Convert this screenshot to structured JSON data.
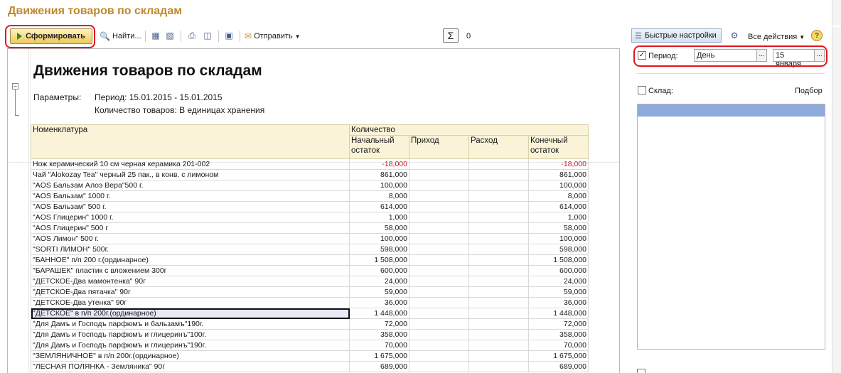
{
  "window": {
    "title": "Движения товаров по складам"
  },
  "toolbar": {
    "generate_label": "Сформировать",
    "find_label": "Найти...",
    "send_label": "Отправить",
    "sum_value": "0"
  },
  "panel_toolbar": {
    "quick_settings_label": "Быстрые настройки",
    "all_actions_label": "Все действия",
    "help_label": "?"
  },
  "settings": {
    "period_label": "Период:",
    "period_checked": true,
    "period_type": "День",
    "period_date": "15 января",
    "warehouse_label": "Склад:",
    "warehouse_checked": false,
    "pick_label": "Подбор"
  },
  "report": {
    "title": "Движения товаров по складам",
    "params_label": "Параметры:",
    "param_period": "Период: 15.01.2015 - 15.01.2015",
    "param_qty": "Количество товаров: В единицах хранения",
    "columns": {
      "name": "Номенклатура",
      "qty_group": "Количество",
      "start": "Начальный остаток",
      "in": "Приход",
      "out": "Расход",
      "end": "Конечный остаток"
    },
    "rows": [
      {
        "name": "Нож керамический 10 см черная керамика 201-002",
        "start": "-18,000",
        "in": "",
        "out": "",
        "end": "-18,000"
      },
      {
        "name": "Чай \"Alokozay Tea\" черный 25 пак., в конв. с лимоном",
        "start": "861,000",
        "in": "",
        "out": "",
        "end": "861,000"
      },
      {
        "name": "\"AOS Бальзам Алоэ Вера\"500 г.",
        "start": "100,000",
        "in": "",
        "out": "",
        "end": "100,000"
      },
      {
        "name": "\"AOS Бальзам\" 1000 г.",
        "start": "8,000",
        "in": "",
        "out": "",
        "end": "8,000"
      },
      {
        "name": "\"AOS Бальзам\" 500 г.",
        "start": "614,000",
        "in": "",
        "out": "",
        "end": "614,000"
      },
      {
        "name": "\"AOS Глицерин\" 1000 г.",
        "start": "1,000",
        "in": "",
        "out": "",
        "end": "1,000"
      },
      {
        "name": "\"AOS Глицерин\" 500 г",
        "start": "58,000",
        "in": "",
        "out": "",
        "end": "58,000"
      },
      {
        "name": "\"AOS Лимон\" 500 г.",
        "start": "100,000",
        "in": "",
        "out": "",
        "end": "100,000"
      },
      {
        "name": "\"SORTI ЛИМОН\" 500г.",
        "start": "598,000",
        "in": "",
        "out": "",
        "end": "598,000"
      },
      {
        "name": "\"БАННОЕ\" п/п 200 г.(ординарное)",
        "start": "1 508,000",
        "in": "",
        "out": "",
        "end": "1 508,000"
      },
      {
        "name": "\"БАРАШЕК\" пластик с вложением 300г",
        "start": "600,000",
        "in": "",
        "out": "",
        "end": "600,000"
      },
      {
        "name": "\"ДЕТСКОЕ-Два мамонтенка\" 90г",
        "start": "24,000",
        "in": "",
        "out": "",
        "end": "24,000"
      },
      {
        "name": "\"ДЕТСКОЕ-Два пятачка\" 90г",
        "start": "59,000",
        "in": "",
        "out": "",
        "end": "59,000"
      },
      {
        "name": "\"ДЕТСКОЕ-Два утенка\" 90г",
        "start": "36,000",
        "in": "",
        "out": "",
        "end": "36,000"
      },
      {
        "name": "\"ДЕТСКОЕ\" в п/п 200г.(ординарное)",
        "start": "1 448,000",
        "in": "",
        "out": "",
        "end": "1 448,000"
      },
      {
        "name": "\"Для Дамъ и Господъ парфюмъ и бальзамъ\"190г.",
        "start": "72,000",
        "in": "",
        "out": "",
        "end": "72,000"
      },
      {
        "name": "\"Для Дамъ и Господъ парфюмъ и глицеринъ\"100г.",
        "start": "358,000",
        "in": "",
        "out": "",
        "end": "358,000"
      },
      {
        "name": "\"Для Дамъ и Господъ парфюмъ и глицеринъ\"190г.",
        "start": "70,000",
        "in": "",
        "out": "",
        "end": "70,000"
      },
      {
        "name": "\"ЗЕМЛЯНИЧНОЕ\" в п/п 200г.(ординарное)",
        "start": "1 675,000",
        "in": "",
        "out": "",
        "end": "1 675,000"
      },
      {
        "name": "\"ЛЕСНАЯ ПОЛЯНКА - Земляника\" 90г",
        "start": "689,000",
        "in": "",
        "out": "",
        "end": "689,000"
      }
    ],
    "selected_row": 14
  },
  "colors": {
    "accent": "#c0882a",
    "highlight_oval": "#e3161e",
    "negative": "#d01818",
    "header_bg": "#faf3d8",
    "list_selection": "#8eaadb"
  }
}
